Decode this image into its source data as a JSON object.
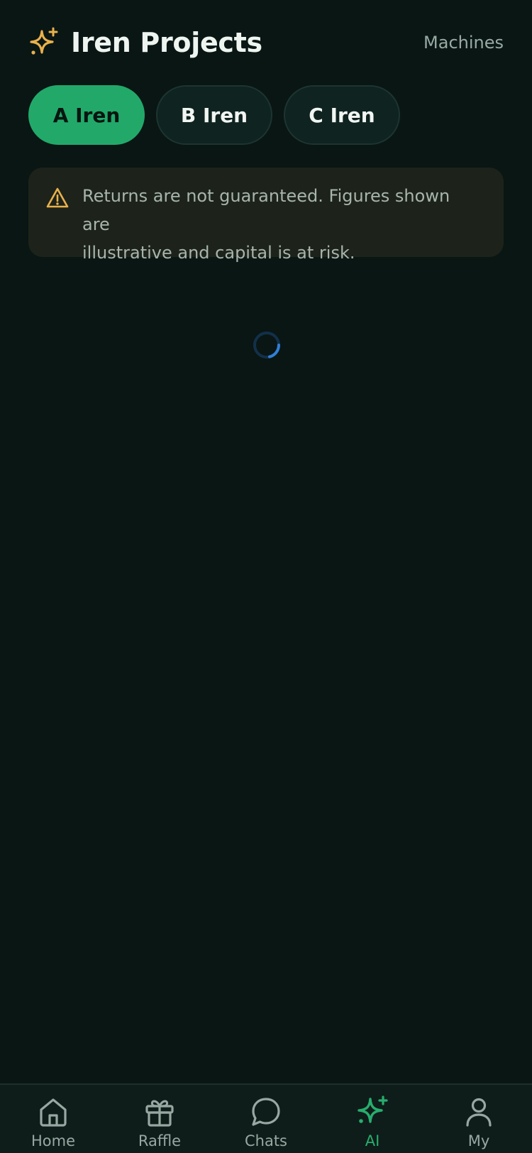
{
  "header": {
    "title": "Iren Projects",
    "title_icon": "sparkles-icon",
    "link_label": "Machines"
  },
  "tabs": [
    {
      "label": "A Iren",
      "active": true
    },
    {
      "label": "B Iren",
      "active": false
    },
    {
      "label": "C Iren",
      "active": false
    }
  ],
  "notice": {
    "icon": "warning-icon",
    "text_line1": "Returns are not guaranteed. Figures shown are",
    "text_line2": "illustrative and capital is at risk."
  },
  "loading": {
    "icon": "spinner-icon"
  },
  "bottom_nav": {
    "items": [
      {
        "label": "Home",
        "icon": "home-icon",
        "active": false
      },
      {
        "label": "Raffle",
        "icon": "gift-icon",
        "active": false
      },
      {
        "label": "Chats",
        "icon": "chat-bubble-icon",
        "active": false
      },
      {
        "label": "AI",
        "icon": "sparkles-icon",
        "active": true
      },
      {
        "label": "My",
        "icon": "user-icon",
        "active": false
      }
    ]
  },
  "colors": {
    "background": "#0a1614",
    "accent": "#22a96a",
    "warning": "#e9b14c",
    "spinner": "#2f7fd6"
  }
}
